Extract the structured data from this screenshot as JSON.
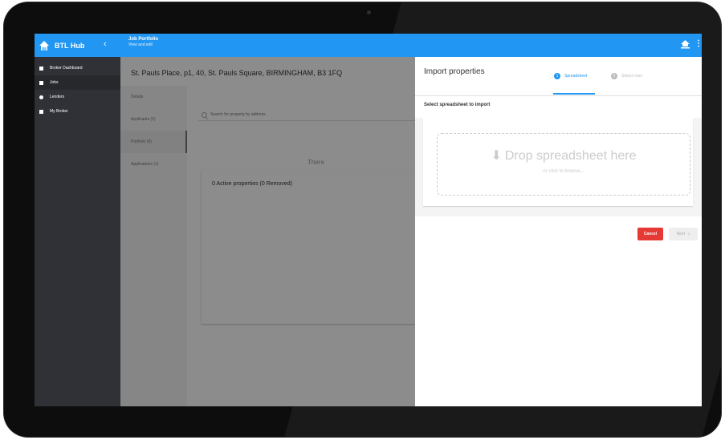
{
  "app": {
    "name": "BTL Hub",
    "collapse_icon": "chevron-left-icon",
    "page_title": "Job Portfolio",
    "page_subtitle": "View and edit",
    "menu_icon": "more-vert-icon",
    "accent_color": "#2196f3"
  },
  "sidebar": {
    "items": [
      {
        "label": "Broker Dashboard",
        "icon": "dashboard-icon"
      },
      {
        "label": "Jobs",
        "icon": "briefcase-icon"
      },
      {
        "label": "Lenders",
        "icon": "bank-icon"
      },
      {
        "label": "My Broker",
        "icon": "document-icon"
      }
    ],
    "active_index": 1
  },
  "content": {
    "address": "St. Pauls Place, p1, 40, St. Pauls Square, BIRMINGHAM, B3 1FQ",
    "subnav": [
      {
        "label": "Details"
      },
      {
        "label": "Applicants (1)"
      },
      {
        "label": "Portfolio (0)"
      },
      {
        "label": "Applications (1)"
      }
    ],
    "active_subnav": 2,
    "search": {
      "placeholder": "Search for property by address",
      "value": ""
    },
    "properties_title": "0 Active properties (0 Removed)",
    "empty_text": "There"
  },
  "import_panel": {
    "title": "Import properties",
    "steps": [
      {
        "number": "1",
        "label": "Spreadsheet",
        "active": true
      },
      {
        "number": "2",
        "label": "Select rows",
        "active": false
      }
    ],
    "select_label": "Select spreadsheet to import",
    "drop_text": "Drop spreadsheet here",
    "drop_subtext": "or click to browse...",
    "cancel_label": "Cancel",
    "next_label": "Next",
    "cancel_color": "#e53935"
  }
}
